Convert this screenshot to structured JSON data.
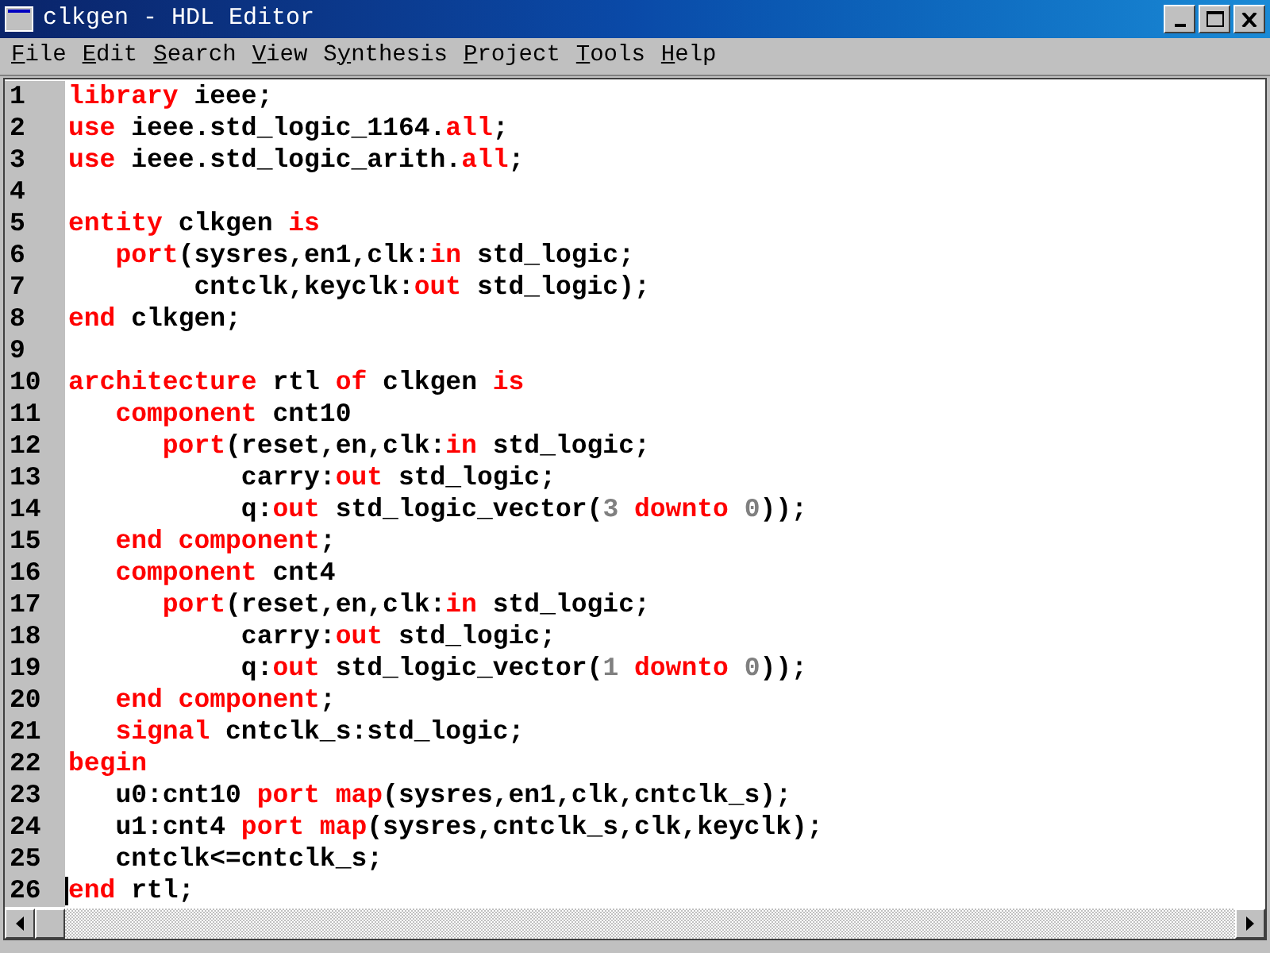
{
  "window": {
    "title": "clkgen - HDL Editor"
  },
  "menu": [
    {
      "key": "F",
      "post": "ile"
    },
    {
      "key": "E",
      "post": "dit"
    },
    {
      "key": "S",
      "post": "earch"
    },
    {
      "key": "V",
      "post": "iew"
    },
    {
      "pre": "S",
      "key": "y",
      "post": "nthesis"
    },
    {
      "key": "P",
      "post": "roject"
    },
    {
      "key": "T",
      "post": "ools"
    },
    {
      "key": "H",
      "post": "elp"
    }
  ],
  "lines": [
    {
      "number": "1",
      "cursor": false,
      "tokens": [
        {
          "kind": "keyword",
          "text": "library"
        },
        {
          "kind": "plain",
          "text": " ieee;"
        }
      ]
    },
    {
      "number": "2",
      "cursor": false,
      "tokens": [
        {
          "kind": "keyword",
          "text": "use"
        },
        {
          "kind": "plain",
          "text": " ieee.std_logic_1164."
        },
        {
          "kind": "keyword",
          "text": "all"
        },
        {
          "kind": "plain",
          "text": ";"
        }
      ]
    },
    {
      "number": "3",
      "cursor": false,
      "tokens": [
        {
          "kind": "keyword",
          "text": "use"
        },
        {
          "kind": "plain",
          "text": " ieee.std_logic_arith."
        },
        {
          "kind": "keyword",
          "text": "all"
        },
        {
          "kind": "plain",
          "text": ";"
        }
      ]
    },
    {
      "number": "4",
      "cursor": false
    },
    {
      "number": "5",
      "cursor": false,
      "tokens": [
        {
          "kind": "keyword",
          "text": "entity"
        },
        {
          "kind": "plain",
          "text": " clkgen "
        },
        {
          "kind": "keyword",
          "text": "is"
        }
      ]
    },
    {
      "number": "6",
      "cursor": false,
      "tokens": [
        {
          "kind": "keyword",
          "text": "   port"
        },
        {
          "kind": "plain",
          "text": "(sysres,en1,clk:"
        },
        {
          "kind": "keyword",
          "text": "in"
        },
        {
          "kind": "plain",
          "text": " std_logic;"
        }
      ]
    },
    {
      "number": "7",
      "cursor": false,
      "tokens": [
        {
          "kind": "plain",
          "text": "        cntclk,keyclk:"
        },
        {
          "kind": "keyword",
          "text": "out"
        },
        {
          "kind": "plain",
          "text": " std_logic);"
        }
      ]
    },
    {
      "number": "8",
      "cursor": false,
      "tokens": [
        {
          "kind": "keyword",
          "text": "end"
        },
        {
          "kind": "plain",
          "text": " clkgen;"
        }
      ]
    },
    {
      "number": "9",
      "cursor": false
    },
    {
      "number": "10",
      "cursor": false,
      "tokens": [
        {
          "kind": "keyword",
          "text": "architecture"
        },
        {
          "kind": "plain",
          "text": " rtl "
        },
        {
          "kind": "keyword",
          "text": "of"
        },
        {
          "kind": "plain",
          "text": " clkgen "
        },
        {
          "kind": "keyword",
          "text": "is"
        }
      ]
    },
    {
      "number": "11",
      "cursor": false,
      "tokens": [
        {
          "kind": "keyword",
          "text": "   component"
        },
        {
          "kind": "plain",
          "text": " cnt10"
        }
      ]
    },
    {
      "number": "12",
      "cursor": false,
      "tokens": [
        {
          "kind": "keyword",
          "text": "      port"
        },
        {
          "kind": "plain",
          "text": "(reset,en,clk:"
        },
        {
          "kind": "keyword",
          "text": "in"
        },
        {
          "kind": "plain",
          "text": " std_logic;"
        }
      ]
    },
    {
      "number": "13",
      "cursor": false,
      "tokens": [
        {
          "kind": "plain",
          "text": "           carry:"
        },
        {
          "kind": "keyword",
          "text": "out"
        },
        {
          "kind": "plain",
          "text": " std_logic;"
        }
      ]
    },
    {
      "number": "14",
      "cursor": false,
      "tokens": [
        {
          "kind": "plain",
          "text": "           q:"
        },
        {
          "kind": "keyword",
          "text": "out"
        },
        {
          "kind": "plain",
          "text": " std_logic_vector("
        },
        {
          "kind": "number",
          "text": "3"
        },
        {
          "kind": "keyword",
          "text": " downto "
        },
        {
          "kind": "number",
          "text": "0"
        },
        {
          "kind": "plain",
          "text": "));"
        }
      ]
    },
    {
      "number": "15",
      "cursor": false,
      "tokens": [
        {
          "kind": "keyword",
          "text": "   end component"
        },
        {
          "kind": "plain",
          "text": ";"
        }
      ]
    },
    {
      "number": "16",
      "cursor": false,
      "tokens": [
        {
          "kind": "keyword",
          "text": "   component"
        },
        {
          "kind": "plain",
          "text": " cnt4"
        }
      ]
    },
    {
      "number": "17",
      "cursor": false,
      "tokens": [
        {
          "kind": "keyword",
          "text": "      port"
        },
        {
          "kind": "plain",
          "text": "(reset,en,clk:"
        },
        {
          "kind": "keyword",
          "text": "in"
        },
        {
          "kind": "plain",
          "text": " std_logic;"
        }
      ]
    },
    {
      "number": "18",
      "cursor": false,
      "tokens": [
        {
          "kind": "plain",
          "text": "           carry:"
        },
        {
          "kind": "keyword",
          "text": "out"
        },
        {
          "kind": "plain",
          "text": " std_logic;"
        }
      ]
    },
    {
      "number": "19",
      "cursor": false,
      "tokens": [
        {
          "kind": "plain",
          "text": "           q:"
        },
        {
          "kind": "keyword",
          "text": "out"
        },
        {
          "kind": "plain",
          "text": " std_logic_vector("
        },
        {
          "kind": "number",
          "text": "1"
        },
        {
          "kind": "keyword",
          "text": " downto "
        },
        {
          "kind": "number",
          "text": "0"
        },
        {
          "kind": "plain",
          "text": "));"
        }
      ]
    },
    {
      "number": "20",
      "cursor": false,
      "tokens": [
        {
          "kind": "keyword",
          "text": "   end component"
        },
        {
          "kind": "plain",
          "text": ";"
        }
      ]
    },
    {
      "number": "21",
      "cursor": false,
      "tokens": [
        {
          "kind": "keyword",
          "text": "   signal"
        },
        {
          "kind": "plain",
          "text": " cntclk_s:std_logic;"
        }
      ]
    },
    {
      "number": "22",
      "cursor": false,
      "tokens": [
        {
          "kind": "keyword",
          "text": "begin"
        }
      ]
    },
    {
      "number": "23",
      "cursor": false,
      "tokens": [
        {
          "kind": "plain",
          "text": "   u0:cnt10 "
        },
        {
          "kind": "keyword",
          "text": "port map"
        },
        {
          "kind": "plain",
          "text": "(sysres,en1,clk,cntclk_s);"
        }
      ]
    },
    {
      "number": "24",
      "cursor": false,
      "tokens": [
        {
          "kind": "plain",
          "text": "   u1:cnt4 "
        },
        {
          "kind": "keyword",
          "text": "port map"
        },
        {
          "kind": "plain",
          "text": "(sysres,cntclk_s,clk,keyclk);"
        }
      ]
    },
    {
      "number": "25",
      "cursor": false,
      "tokens": [
        {
          "kind": "plain",
          "text": "   cntclk<=cntclk_s;"
        }
      ]
    },
    {
      "number": "26",
      "cursor": true,
      "tokens": [
        {
          "kind": "keyword",
          "text": "end"
        },
        {
          "kind": "plain",
          "text": " rtl;"
        }
      ]
    }
  ]
}
